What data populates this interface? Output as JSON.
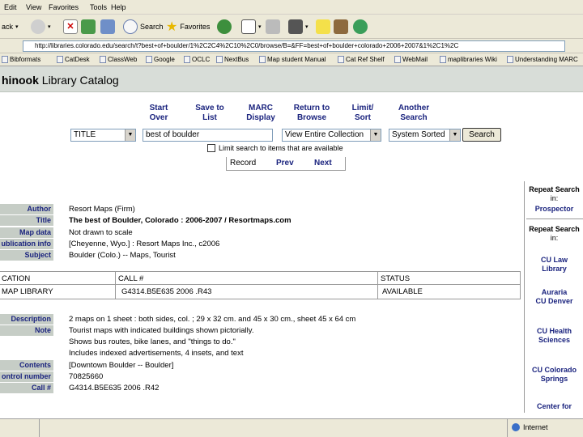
{
  "menu": [
    "Edit",
    "View",
    "Favorites",
    "Tools",
    "Help"
  ],
  "toolbar": {
    "back": "ack",
    "search": "Search",
    "favorites": "Favorites"
  },
  "address": {
    "url": "http://libraries.colorado.edu/search/t?best+of+boulder/1%2C2C4%2C10%2C0/browse/B=&FF=best+of+boulder+colorado+2006+2007&1%2C1%2C"
  },
  "links": [
    "Bibformats",
    "CatDesk",
    "ClassWeb",
    "Google",
    "OCLC",
    "NextBus",
    "Map student Manual",
    "Cat Ref Shelf",
    "WebMail",
    "maplibraries Wiki",
    "Understanding MARC"
  ],
  "banner": {
    "bold": "hinook",
    "rest": " Library Catalog"
  },
  "nav": [
    {
      "l1": "Start",
      "l2": "Over"
    },
    {
      "l1": "Save to",
      "l2": "List"
    },
    {
      "l1": "MARC",
      "l2": "Display"
    },
    {
      "l1": "Return to",
      "l2": "Browse"
    },
    {
      "l1": "Limit/",
      "l2": "Sort"
    },
    {
      "l1": "Another",
      "l2": "Search"
    }
  ],
  "search": {
    "field": "TITLE",
    "term": "best of boulder",
    "scope": "View Entire Collection",
    "sort": "System Sorted",
    "button": "Search",
    "limit": "Limit search to items that are available"
  },
  "recnav": {
    "record": "Record",
    "prev": "Prev",
    "next": "Next"
  },
  "right": {
    "repeat1": "Repeat Search",
    "in1": "in:",
    "prospector": "Prospector",
    "repeat2": "Repeat Search",
    "in2": "in:",
    "cu_law_1": "CU Law",
    "cu_law_2": "Library",
    "auraria_1": "Auraria",
    "auraria_2": "CU Denver",
    "health_1": "CU Health",
    "health_2": "Sciences",
    "springs_1": "CU Colorado",
    "springs_2": "Springs",
    "center": "Center for"
  },
  "record": {
    "author_lbl": "Author",
    "author": "Resort Maps (Firm)",
    "title_lbl": "Title",
    "title": "The best of Boulder, Colorado : 2006-2007 / Resortmaps.com",
    "mapdata_lbl": "Map data",
    "mapdata": "Not drawn to scale",
    "pub_lbl": "ublication info",
    "pub": "[Cheyenne, Wyo.] : Resort Maps Inc., c2006",
    "subject_lbl": "Subject",
    "subject": "Boulder (Colo.) -- Maps, Tourist"
  },
  "holdings": {
    "h_loc": "CATION",
    "h_call": "CALL #",
    "h_status": "STATUS",
    "loc": "MAP LIBRARY",
    "call": "G4314.B5E635 2006 .R43",
    "status": "AVAILABLE"
  },
  "details": {
    "desc_lbl": "Description",
    "desc": "2 maps on 1 sheet : both sides, col. ; 29 x 32 cm. and 45 x 30 cm., sheet 45 x 64 cm",
    "note_lbl": "Note",
    "note1": "Tourist maps with indicated buildings shown pictorially.",
    "note2": "Shows bus routes, bike lanes, and \"things to do.\"",
    "note3": "Includes indexed advertisements, 4 insets, and text",
    "contents_lbl": "Contents",
    "contents": "[Downtown Boulder -- Boulder]",
    "control_lbl": "ontrol number",
    "control": "70825660",
    "call_lbl": "Call #",
    "call": "G4314.B5E635 2006 .R42"
  },
  "status": {
    "zone": "Internet"
  }
}
